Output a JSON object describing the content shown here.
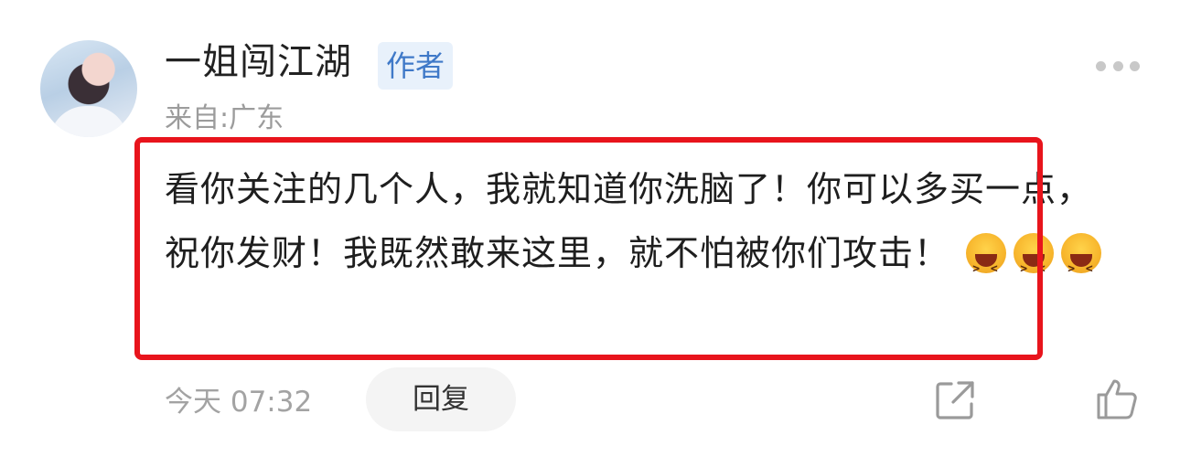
{
  "author": {
    "name": "一姐闯江湖",
    "badge": "作者",
    "location": "来自:广东"
  },
  "comment": {
    "text": "看你关注的几个人，我就知道你洗脑了！你可以多买一点，祝你发财！我既然敢来这里，就不怕被你们攻击！",
    "emojis": [
      "laughing-emoji",
      "laughing-emoji",
      "laughing-emoji"
    ]
  },
  "footer": {
    "time": "今天 07:32",
    "reply_label": "回复"
  },
  "icons": {
    "more": "more-dots-icon",
    "share": "share-icon",
    "like": "thumbs-up-icon"
  },
  "colors": {
    "highlight_border": "#e8141c",
    "badge_bg": "#e8f1fb",
    "badge_text": "#3f79c8"
  }
}
